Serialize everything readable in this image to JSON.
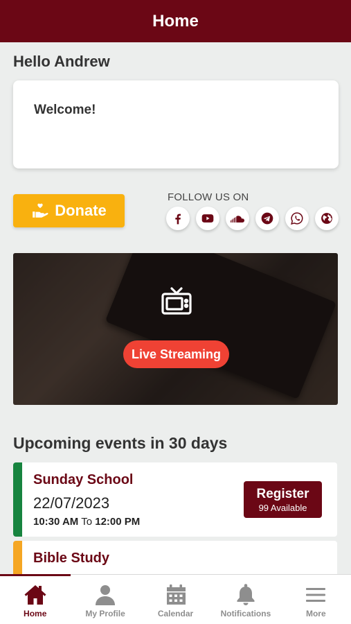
{
  "header": {
    "title": "Home"
  },
  "greeting": "Hello Andrew",
  "welcome": {
    "text": "Welcome!"
  },
  "donate": {
    "label": "Donate"
  },
  "follow": {
    "label": "FOLLOW US ON",
    "icons": [
      "facebook-icon",
      "youtube-icon",
      "soundcloud-icon",
      "telegram-icon",
      "whatsapp-icon",
      "globe-icon"
    ]
  },
  "stream": {
    "label": "Live Streaming",
    "icon": "tv-icon"
  },
  "events": {
    "title": "Upcoming events in 30 days",
    "items": [
      {
        "title": "Sunday School",
        "date": "22/07/2023",
        "start": "10:30 AM",
        "to": "To",
        "end": "12:00 PM",
        "register_label": "Register",
        "available": "99 Available",
        "accent": "#17843f"
      },
      {
        "title": "Bible Study",
        "accent": "#f5a623"
      }
    ]
  },
  "tabbar": {
    "items": [
      {
        "label": "Home",
        "icon": "home-icon",
        "active": true
      },
      {
        "label": "My Profile",
        "icon": "person-icon"
      },
      {
        "label": "Calendar",
        "icon": "calendar-icon"
      },
      {
        "label": "Notifications",
        "icon": "bell-icon"
      },
      {
        "label": "More",
        "icon": "menu-icon"
      }
    ]
  },
  "colors": {
    "brand": "#6b0715",
    "donate": "#f9b10f",
    "live": "#ef4234",
    "background": "#eceeed"
  }
}
